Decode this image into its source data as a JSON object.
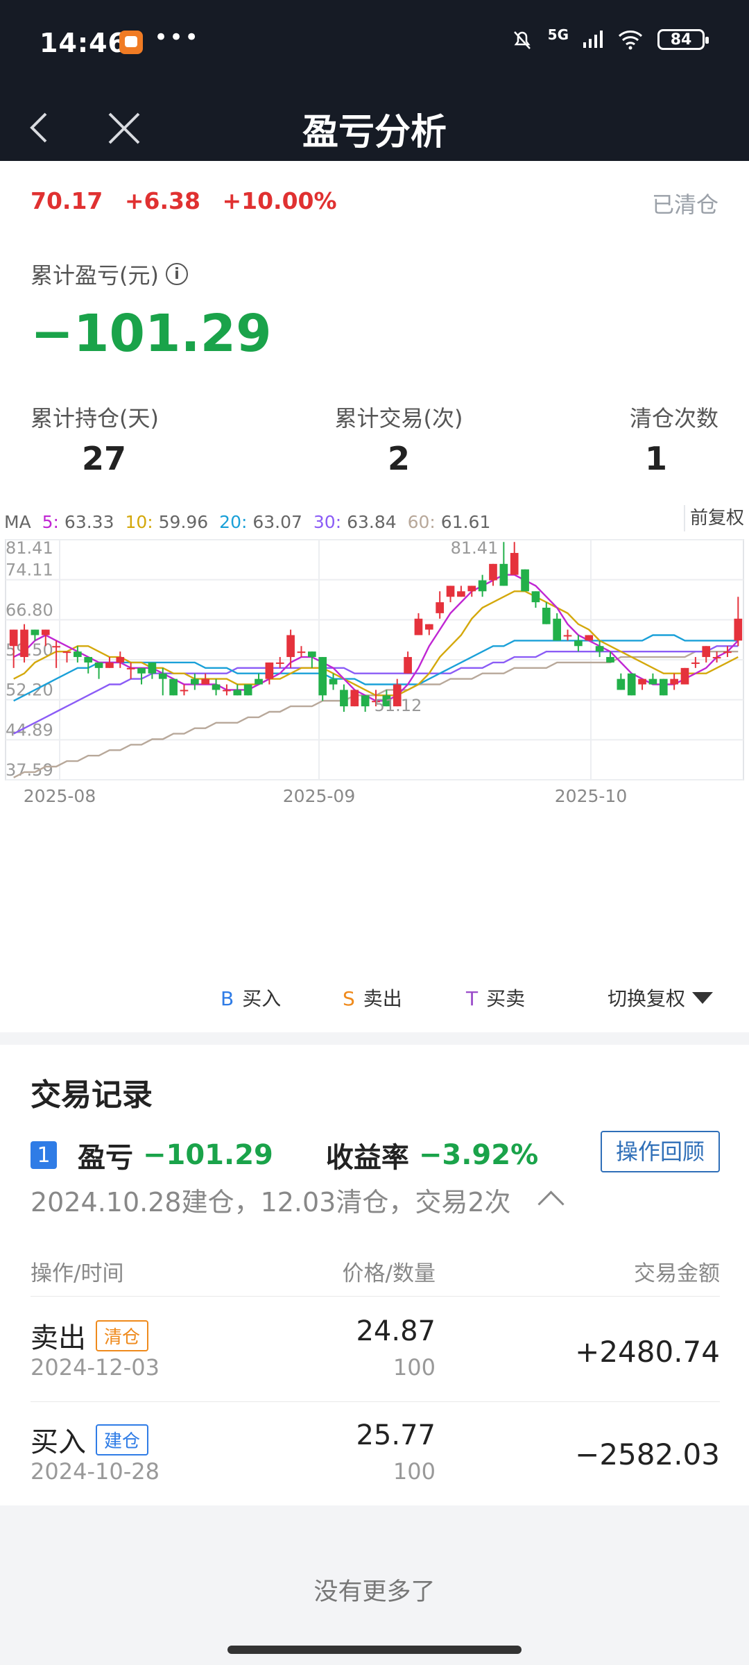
{
  "status": {
    "time": "14:46",
    "dots": "•••",
    "network": "5G",
    "battery": "84"
  },
  "nav": {
    "title": "盈亏分析"
  },
  "stock": {
    "price": "70.17",
    "change": "+6.38",
    "change_pct": "+10.00%",
    "status": "已清仓"
  },
  "pnl": {
    "label": "累计盈亏(元)",
    "value": "−101.29"
  },
  "stats": [
    {
      "label": "累计持仓(天)",
      "value": "27"
    },
    {
      "label": "累计交易(次)",
      "value": "2"
    },
    {
      "label": "清仓次数",
      "value": "1"
    }
  ],
  "ma": {
    "prefix": "MA",
    "items": [
      {
        "key": "5:",
        "value": "63.33",
        "color": "#c026d3"
      },
      {
        "key": "10:",
        "value": "59.96",
        "color": "#d4a80b"
      },
      {
        "key": "20:",
        "value": "63.07",
        "color": "#1aa0d8"
      },
      {
        "key": "30:",
        "value": "63.84",
        "color": "#8b5cf6"
      },
      {
        "key": "60:",
        "value": "61.61",
        "color": "#b8a89a"
      }
    ],
    "adjust_label": "前复权"
  },
  "chart_data": {
    "type": "candlestick",
    "y_ticks": [
      "81.41",
      "74.11",
      "66.80",
      "59.50",
      "52.20",
      "44.89",
      "37.59"
    ],
    "ylim": [
      37.59,
      81.41
    ],
    "x_ticks": [
      "2025-08",
      "2025-09",
      "2025-10"
    ],
    "annotations": {
      "high": "81.41",
      "low": "51.12"
    },
    "candles": [
      [
        62,
        65,
        58,
        60
      ],
      [
        60,
        65,
        59,
        66
      ],
      [
        65,
        64,
        63,
        65
      ],
      [
        64,
        65,
        62,
        63
      ],
      [
        62,
        62,
        58,
        63
      ],
      [
        61,
        61,
        59,
        60
      ],
      [
        61,
        60,
        59,
        62
      ],
      [
        60,
        59,
        57,
        60
      ],
      [
        59,
        58,
        56,
        59
      ],
      [
        58,
        59,
        58,
        60
      ],
      [
        59,
        60,
        58,
        61
      ],
      [
        58,
        58,
        56,
        59
      ],
      [
        58,
        57,
        55,
        58
      ],
      [
        59,
        57,
        56,
        59
      ],
      [
        57,
        56,
        53,
        58
      ],
      [
        56,
        53,
        53,
        56
      ],
      [
        54,
        54,
        53,
        55
      ],
      [
        56,
        55,
        54,
        57
      ],
      [
        55,
        56,
        55,
        57
      ],
      [
        55,
        54,
        53,
        56
      ],
      [
        54,
        54,
        53,
        55
      ],
      [
        54,
        53,
        53,
        55
      ],
      [
        55,
        53,
        53,
        55
      ],
      [
        56,
        55,
        55,
        57
      ],
      [
        56,
        59,
        55,
        59
      ],
      [
        59,
        59,
        58,
        60
      ],
      [
        60,
        64,
        58,
        65
      ],
      [
        61,
        61,
        60,
        62
      ],
      [
        61,
        60,
        58,
        61
      ],
      [
        60,
        53,
        52,
        60
      ],
      [
        56,
        55,
        54,
        57
      ],
      [
        54,
        51,
        50,
        55
      ],
      [
        51,
        54,
        51,
        54
      ],
      [
        53,
        51,
        50,
        53
      ],
      [
        52,
        52,
        51,
        54
      ],
      [
        53,
        51,
        51,
        54
      ],
      [
        51,
        55,
        51,
        56
      ],
      [
        57,
        60,
        57,
        61
      ],
      [
        64,
        67,
        64,
        68
      ],
      [
        65,
        66,
        64,
        66
      ],
      [
        68,
        70,
        67,
        72
      ],
      [
        71,
        73,
        70,
        72
      ],
      [
        71,
        72,
        71,
        73
      ],
      [
        72,
        73,
        71,
        73
      ],
      [
        74,
        72,
        71,
        75
      ],
      [
        74,
        77,
        73,
        75
      ],
      [
        77,
        73,
        73,
        81
      ],
      [
        75,
        79,
        75,
        81
      ],
      [
        76,
        72,
        72,
        76
      ],
      [
        72,
        70,
        69,
        72
      ],
      [
        69,
        66,
        66,
        70
      ],
      [
        67,
        63,
        63,
        68
      ],
      [
        64,
        64,
        63,
        65
      ],
      [
        63,
        62,
        61,
        64
      ],
      [
        63,
        64,
        63,
        64
      ],
      [
        62,
        61,
        60,
        63
      ],
      [
        60,
        59,
        59,
        61
      ],
      [
        56,
        54,
        54,
        57
      ],
      [
        57,
        53,
        53,
        57
      ],
      [
        55,
        56,
        54,
        56
      ],
      [
        56,
        55,
        55,
        57
      ],
      [
        56,
        53,
        53,
        56
      ],
      [
        55,
        56,
        54,
        57
      ],
      [
        55,
        58,
        55,
        58
      ],
      [
        59,
        59,
        58,
        60
      ],
      [
        60,
        62,
        59,
        62
      ],
      [
        60,
        60,
        59,
        61
      ],
      [
        61,
        61,
        60,
        62
      ],
      [
        63,
        67,
        62,
        71
      ]
    ],
    "ma5": [
      60,
      61,
      63,
      64,
      63,
      62,
      61,
      60,
      59,
      59,
      59,
      58,
      58,
      58,
      57,
      56,
      55,
      55,
      55,
      55,
      54,
      54,
      54,
      55,
      56,
      57,
      59,
      60,
      60,
      59,
      58,
      56,
      54,
      53,
      52,
      52,
      53,
      55,
      58,
      62,
      65,
      68,
      70,
      72,
      73,
      74,
      75,
      75,
      74,
      73,
      71,
      69,
      66,
      64,
      63,
      62,
      61,
      59,
      57,
      56,
      55,
      55,
      55,
      56,
      57,
      58,
      60,
      61,
      63
    ],
    "ma10": [
      56,
      57,
      59,
      60,
      61,
      61,
      62,
      62,
      61,
      60,
      60,
      59,
      59,
      58,
      58,
      57,
      57,
      56,
      56,
      56,
      56,
      55,
      55,
      55,
      56,
      56,
      57,
      58,
      58,
      58,
      57,
      56,
      55,
      54,
      53,
      53,
      53,
      54,
      55,
      57,
      60,
      62,
      64,
      67,
      69,
      70,
      71,
      72,
      72,
      71,
      70,
      69,
      68,
      66,
      65,
      63,
      62,
      61,
      60,
      59,
      58,
      57,
      57,
      57,
      57,
      57,
      58,
      59,
      60
    ],
    "ma20": [
      52,
      53,
      54,
      55,
      56,
      57,
      58,
      58,
      59,
      59,
      59,
      59,
      59,
      59,
      59,
      59,
      59,
      59,
      58,
      58,
      58,
      57,
      57,
      57,
      57,
      57,
      57,
      57,
      57,
      57,
      56,
      56,
      56,
      55,
      55,
      55,
      55,
      55,
      55,
      56,
      57,
      58,
      59,
      60,
      61,
      62,
      62,
      63,
      63,
      63,
      63,
      63,
      63,
      63,
      63,
      63,
      63,
      63,
      63,
      63,
      64,
      64,
      64,
      63,
      63,
      63,
      63,
      63,
      63
    ],
    "ma30": [
      46,
      47,
      48,
      49,
      50,
      51,
      52,
      53,
      54,
      55,
      55,
      56,
      56,
      57,
      57,
      57,
      57,
      57,
      57,
      57,
      57,
      58,
      58,
      58,
      58,
      58,
      58,
      58,
      58,
      58,
      58,
      58,
      57,
      57,
      57,
      57,
      57,
      57,
      57,
      57,
      57,
      57,
      58,
      58,
      58,
      59,
      59,
      60,
      60,
      60,
      61,
      61,
      61,
      61,
      61,
      61,
      61,
      61,
      61,
      61,
      61,
      61,
      61,
      61,
      61,
      61,
      62,
      62,
      62
    ],
    "ma60": [
      38,
      39,
      39,
      40,
      40,
      41,
      41,
      42,
      42,
      43,
      43,
      44,
      44,
      45,
      45,
      46,
      46,
      47,
      47,
      48,
      48,
      48,
      49,
      49,
      50,
      50,
      51,
      51,
      51,
      52,
      52,
      52,
      53,
      53,
      53,
      54,
      54,
      54,
      55,
      55,
      55,
      56,
      56,
      56,
      57,
      57,
      57,
      58,
      58,
      58,
      58,
      59,
      59,
      59,
      59,
      59,
      59,
      60,
      60,
      60,
      60,
      60,
      60,
      60,
      61,
      61,
      61,
      61,
      61
    ]
  },
  "legend": [
    {
      "letter": "B",
      "label": "买入",
      "color": "#2f7ce6"
    },
    {
      "letter": "S",
      "label": "卖出",
      "color": "#ef8a1c"
    },
    {
      "letter": "T",
      "label": "买卖",
      "color": "#9b4dca"
    }
  ],
  "switch_label": "切换复权",
  "records": {
    "title": "交易记录",
    "index": "1",
    "pnl_label": "盈亏",
    "pnl_value": "−101.29",
    "yield_label": "收益率",
    "yield_value": "−3.92%",
    "review_btn": "操作回顾",
    "summary": "2024.10.28建仓，12.03清仓，交易2次",
    "headers": [
      "操作/时间",
      "价格/数量",
      "交易金额"
    ],
    "rows": [
      {
        "op": "卖出",
        "tag": "清仓",
        "date": "2024-12-03",
        "price": "24.87",
        "qty": "100",
        "amount": "+2480.74"
      },
      {
        "op": "买入",
        "tag": "建仓",
        "date": "2024-10-28",
        "price": "25.77",
        "qty": "100",
        "amount": "−2582.03"
      }
    ],
    "no_more": "没有更多了"
  }
}
